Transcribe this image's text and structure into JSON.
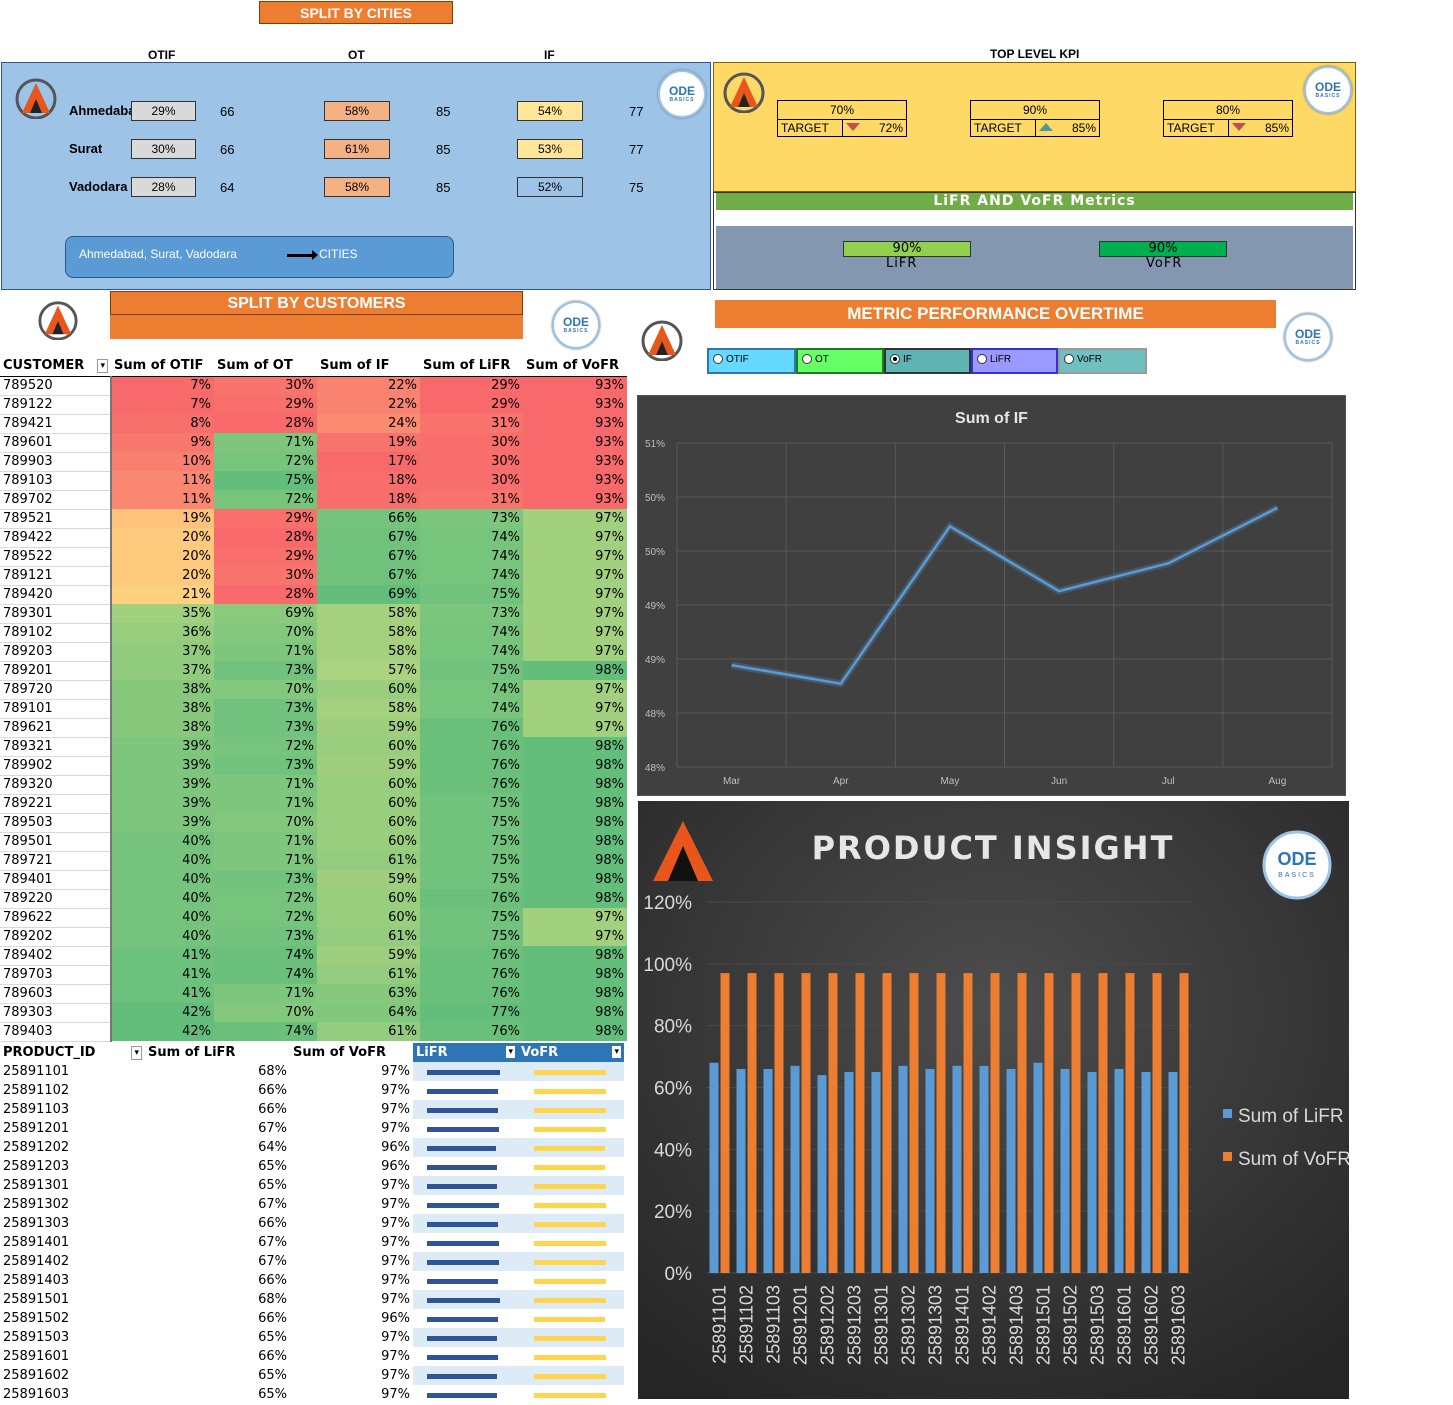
{
  "cities": {
    "banner": "SPLIT BY CITIES",
    "headers": [
      "OTIF",
      "OT",
      "IF"
    ],
    "rows": [
      {
        "name": "Ahmedabad",
        "otif": "29%",
        "otif_n": "66",
        "ot": "58%",
        "ot_n": "85",
        "if": "54%",
        "if_n": "77"
      },
      {
        "name": "Surat",
        "otif": "30%",
        "otif_n": "66",
        "ot": "61%",
        "ot_n": "85",
        "if": "53%",
        "if_n": "77"
      },
      {
        "name": "Vadodara",
        "otif": "28%",
        "otif_n": "64",
        "ot": "58%",
        "ot_n": "85",
        "if": "52%",
        "if_n": "75"
      }
    ],
    "filter_values": "Ahmedabad,  Surat, Vadodara",
    "filter_label": "CITIES"
  },
  "kpi": {
    "title": "TOP LEVEL KPI",
    "cards": [
      {
        "value": "70%",
        "target_label": "TARGET",
        "target": "72%",
        "trend": "down"
      },
      {
        "value": "90%",
        "target_label": "TARGET",
        "target": "85%",
        "trend": "up"
      },
      {
        "value": "80%",
        "target_label": "TARGET",
        "target": "85%",
        "trend": "down"
      }
    ],
    "metrics_title": "LiFR AND VoFR Metrics",
    "lifr_value": "90%",
    "lifr_label": "LiFR",
    "vofr_value": "90%",
    "vofr_label": "VoFR"
  },
  "customers": {
    "banner": "SPLIT BY CUSTOMERS",
    "headers": [
      "CUSTOMER",
      "Sum of OTIF",
      "Sum of OT",
      "Sum of IF",
      "Sum of LiFR",
      "Sum of VoFR"
    ],
    "rows": [
      [
        "789520",
        "7%",
        "30%",
        "22%",
        "29%",
        "93%"
      ],
      [
        "789122",
        "7%",
        "29%",
        "22%",
        "29%",
        "93%"
      ],
      [
        "789421",
        "8%",
        "28%",
        "24%",
        "31%",
        "93%"
      ],
      [
        "789601",
        "9%",
        "71%",
        "19%",
        "30%",
        "93%"
      ],
      [
        "789903",
        "10%",
        "72%",
        "17%",
        "30%",
        "93%"
      ],
      [
        "789103",
        "11%",
        "75%",
        "18%",
        "30%",
        "93%"
      ],
      [
        "789702",
        "11%",
        "72%",
        "18%",
        "31%",
        "93%"
      ],
      [
        "789521",
        "19%",
        "29%",
        "66%",
        "73%",
        "97%"
      ],
      [
        "789422",
        "20%",
        "28%",
        "67%",
        "74%",
        "97%"
      ],
      [
        "789522",
        "20%",
        "29%",
        "67%",
        "74%",
        "97%"
      ],
      [
        "789121",
        "20%",
        "30%",
        "67%",
        "74%",
        "97%"
      ],
      [
        "789420",
        "21%",
        "28%",
        "69%",
        "75%",
        "97%"
      ],
      [
        "789301",
        "35%",
        "69%",
        "58%",
        "73%",
        "97%"
      ],
      [
        "789102",
        "36%",
        "70%",
        "58%",
        "74%",
        "97%"
      ],
      [
        "789203",
        "37%",
        "71%",
        "58%",
        "74%",
        "97%"
      ],
      [
        "789201",
        "37%",
        "73%",
        "57%",
        "75%",
        "98%"
      ],
      [
        "789720",
        "38%",
        "70%",
        "60%",
        "74%",
        "97%"
      ],
      [
        "789101",
        "38%",
        "73%",
        "58%",
        "74%",
        "97%"
      ],
      [
        "789621",
        "38%",
        "73%",
        "59%",
        "76%",
        "97%"
      ],
      [
        "789321",
        "39%",
        "72%",
        "60%",
        "76%",
        "98%"
      ],
      [
        "789902",
        "39%",
        "73%",
        "59%",
        "76%",
        "98%"
      ],
      [
        "789320",
        "39%",
        "71%",
        "60%",
        "76%",
        "98%"
      ],
      [
        "789221",
        "39%",
        "71%",
        "60%",
        "75%",
        "98%"
      ],
      [
        "789503",
        "39%",
        "70%",
        "60%",
        "75%",
        "98%"
      ],
      [
        "789501",
        "40%",
        "71%",
        "60%",
        "75%",
        "98%"
      ],
      [
        "789721",
        "40%",
        "71%",
        "61%",
        "75%",
        "98%"
      ],
      [
        "789401",
        "40%",
        "73%",
        "59%",
        "75%",
        "98%"
      ],
      [
        "789220",
        "40%",
        "72%",
        "60%",
        "76%",
        "98%"
      ],
      [
        "789622",
        "40%",
        "72%",
        "60%",
        "75%",
        "97%"
      ],
      [
        "789202",
        "40%",
        "73%",
        "61%",
        "75%",
        "97%"
      ],
      [
        "789402",
        "41%",
        "74%",
        "59%",
        "76%",
        "98%"
      ],
      [
        "789703",
        "41%",
        "74%",
        "61%",
        "76%",
        "98%"
      ],
      [
        "789603",
        "41%",
        "71%",
        "63%",
        "76%",
        "98%"
      ],
      [
        "789303",
        "42%",
        "70%",
        "64%",
        "77%",
        "98%"
      ],
      [
        "789403",
        "42%",
        "74%",
        "61%",
        "76%",
        "98%"
      ]
    ]
  },
  "products": {
    "headers": [
      "PRODUCT_ID",
      "Sum of LiFR",
      "Sum of VoFR",
      "LiFR",
      "VoFR"
    ],
    "rows": [
      [
        "25891101",
        "68%",
        "97%"
      ],
      [
        "25891102",
        "66%",
        "97%"
      ],
      [
        "25891103",
        "66%",
        "97%"
      ],
      [
        "25891201",
        "67%",
        "97%"
      ],
      [
        "25891202",
        "64%",
        "96%"
      ],
      [
        "25891203",
        "65%",
        "96%"
      ],
      [
        "25891301",
        "65%",
        "97%"
      ],
      [
        "25891302",
        "67%",
        "97%"
      ],
      [
        "25891303",
        "66%",
        "97%"
      ],
      [
        "25891401",
        "67%",
        "97%"
      ],
      [
        "25891402",
        "67%",
        "97%"
      ],
      [
        "25891403",
        "66%",
        "97%"
      ],
      [
        "25891501",
        "68%",
        "97%"
      ],
      [
        "25891502",
        "66%",
        "96%"
      ],
      [
        "25891503",
        "65%",
        "97%"
      ],
      [
        "25891601",
        "66%",
        "97%"
      ],
      [
        "25891602",
        "65%",
        "97%"
      ],
      [
        "25891603",
        "65%",
        "97%"
      ]
    ]
  },
  "metric_perf": {
    "banner": "METRIC PERFORMANCE OVERTIME",
    "options": [
      "OTIF",
      "OT",
      "IF",
      "LiFR",
      "VoFR"
    ],
    "selected": "IF"
  },
  "logos": {
    "code_top": "ODE",
    "code_sub": "BASICS"
  },
  "chart_data": [
    {
      "type": "line",
      "title": "Sum of IF",
      "categories": [
        "Mar",
        "Apr",
        "May",
        "Jun",
        "Jul",
        "Aug"
      ],
      "series": [
        {
          "values": [
            48.6,
            48.4,
            50.1,
            49.4,
            49.7,
            50.3
          ]
        }
      ],
      "ytick_labels": [
        "51%",
        "50%",
        "50%",
        "49%",
        "49%",
        "48%",
        "48%"
      ],
      "ylim": [
        47.5,
        51.0
      ],
      "grid": true,
      "colors": {
        "background": "#404040",
        "line": "#5b9bd5"
      }
    },
    {
      "type": "bar",
      "title": "PRODUCT INSIGHT",
      "categories": [
        "25891101",
        "25891102",
        "25891103",
        "25891201",
        "25891202",
        "25891203",
        "25891301",
        "25891302",
        "25891303",
        "25891401",
        "25891402",
        "25891403",
        "25891501",
        "25891502",
        "25891503",
        "25891601",
        "25891602",
        "25891603"
      ],
      "series": [
        {
          "name": "Sum of LiFR",
          "values": [
            68,
            66,
            66,
            67,
            64,
            65,
            65,
            67,
            66,
            67,
            67,
            66,
            68,
            66,
            65,
            66,
            65,
            65
          ]
        },
        {
          "name": "Sum of VoFR",
          "values": [
            97,
            97,
            97,
            97,
            97,
            97,
            97,
            97,
            97,
            97,
            97,
            97,
            97,
            97,
            97,
            97,
            97,
            97
          ]
        }
      ],
      "ytick_labels": [
        "0%",
        "20%",
        "40%",
        "60%",
        "80%",
        "100%",
        "120%"
      ],
      "ylim": [
        0,
        120
      ],
      "legend": "right",
      "colors": {
        "lifr": "#5b9bd5",
        "vofr": "#ed7d31",
        "background": "#3a3a3a"
      }
    }
  ]
}
